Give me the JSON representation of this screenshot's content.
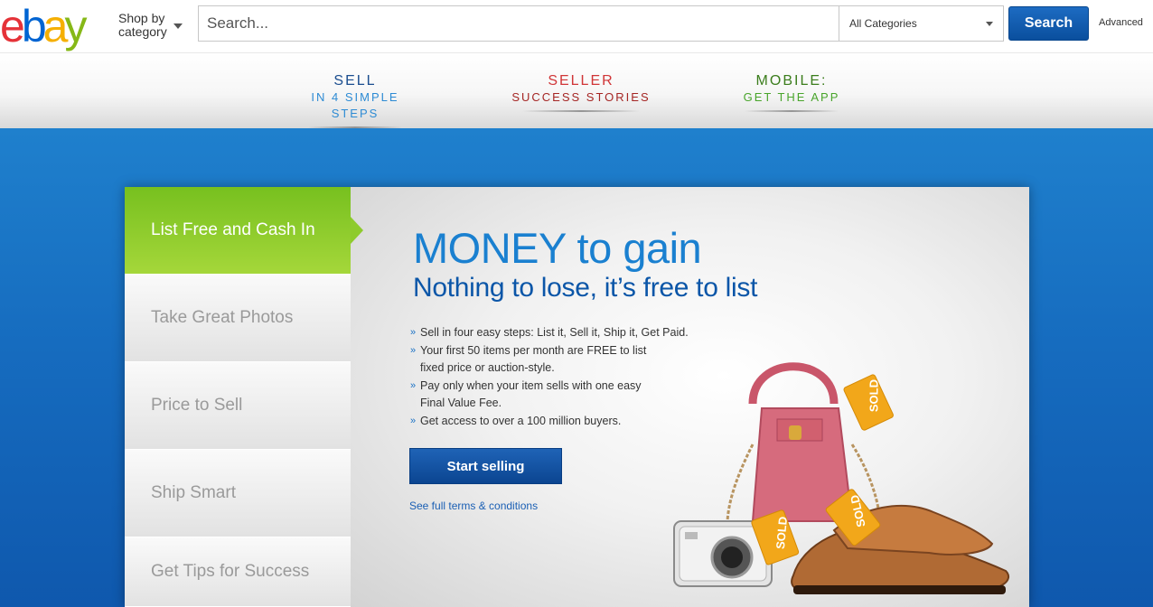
{
  "header": {
    "logo": {
      "letters": [
        "e",
        "b",
        "a",
        "y"
      ],
      "colors": [
        "#e53238",
        "#0064d2",
        "#f5af02",
        "#86b817"
      ]
    },
    "shop_by_line1": "Shop by",
    "shop_by_line2": "category",
    "search_placeholder": "Search...",
    "category_selected": "All Categories",
    "search_button": "Search",
    "advanced_link": "Advanced"
  },
  "nav": {
    "sell": {
      "line1": "SELL",
      "line2": "IN 4 SIMPLE STEPS"
    },
    "stories": {
      "line1": "SELLER",
      "line2": "SUCCESS STORIES"
    },
    "mobile": {
      "line1": "MOBILE:",
      "line2": "GET THE APP"
    }
  },
  "sidebar": {
    "items": [
      {
        "label": "List Free and Cash In",
        "active": true
      },
      {
        "label": "Take Great Photos",
        "active": false
      },
      {
        "label": "Price to Sell",
        "active": false
      },
      {
        "label": "Ship Smart",
        "active": false
      },
      {
        "label": "Get Tips for Success",
        "active": false
      }
    ]
  },
  "content": {
    "headline": "MONEY to gain",
    "subhead": "Nothing to lose, it’s free to list",
    "bullets": [
      "Sell in four easy steps: List it, Sell it, Ship it, Get Paid.",
      "Your first 50 items per month are FREE to list fixed price or auction-style.",
      "Pay only when your item sells with one easy Final Value Fee.",
      "Get access to over a 100 million buyers."
    ],
    "cta_button": "Start selling",
    "terms_link": "See full terms & conditions",
    "sold_tag": "SOLD"
  },
  "colors": {
    "accent_blue": "#1a80d0",
    "active_tab_green": "#8ecb2c",
    "hero_blue": "#166cbf"
  }
}
